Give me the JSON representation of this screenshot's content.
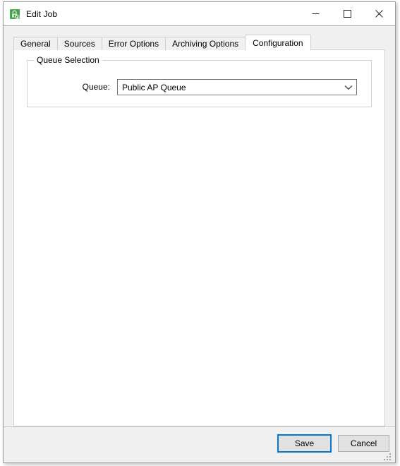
{
  "window": {
    "title": "Edit Job",
    "icon": "job-lock-icon",
    "controls": {
      "minimize": "minimize-icon",
      "maximize": "maximize-icon",
      "close": "close-icon"
    }
  },
  "tabs": [
    {
      "label": "General",
      "selected": false
    },
    {
      "label": "Sources",
      "selected": false
    },
    {
      "label": "Error Options",
      "selected": false
    },
    {
      "label": "Archiving Options",
      "selected": false
    },
    {
      "label": "Configuration",
      "selected": true
    }
  ],
  "configuration": {
    "group": {
      "title": "Queue Selection",
      "fields": [
        {
          "label": "Queue:",
          "control": "combobox",
          "value": "Public AP Queue",
          "arrow_icon": "chevron-down-icon"
        }
      ]
    }
  },
  "footer": {
    "save_label": "Save",
    "cancel_label": "Cancel"
  },
  "colors": {
    "accent": "#0078d7",
    "window_background": "#f0f0f0",
    "panel_background": "#ffffff",
    "border": "#cfcfcf",
    "icon_green": "#3fa13f"
  }
}
